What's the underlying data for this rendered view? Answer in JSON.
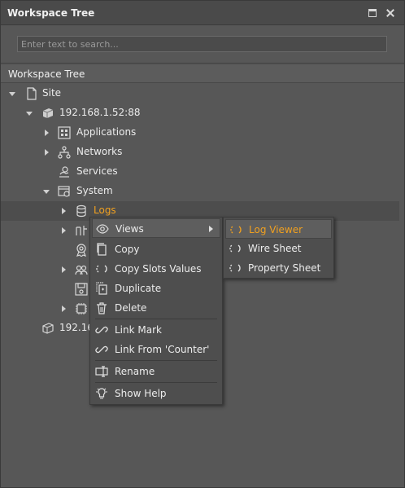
{
  "panel": {
    "title": "Workspace Tree"
  },
  "search": {
    "placeholder": "Enter text to search..."
  },
  "tree": {
    "header": "Workspace Tree",
    "nodes": {
      "site": "Site",
      "device": "192.168.1.52:88",
      "applications": "Applications",
      "networks": "Networks",
      "services": "Services",
      "system": "System",
      "logs": "Logs",
      "device2": "192.16"
    }
  },
  "context_menu": {
    "views": "Views",
    "copy": "Copy",
    "copy_slots": "Copy Slots Values",
    "duplicate": "Duplicate",
    "delete": "Delete",
    "link_mark": "Link Mark",
    "link_from": "Link From 'Counter'",
    "rename": "Rename",
    "show_help": "Show Help"
  },
  "submenu": {
    "log_viewer": "Log Viewer",
    "wire_sheet": "Wire Sheet",
    "property_sheet": "Property Sheet"
  },
  "colors": {
    "highlight": "#f0a020",
    "background": "#575757",
    "menu": "#4e4e4e"
  }
}
